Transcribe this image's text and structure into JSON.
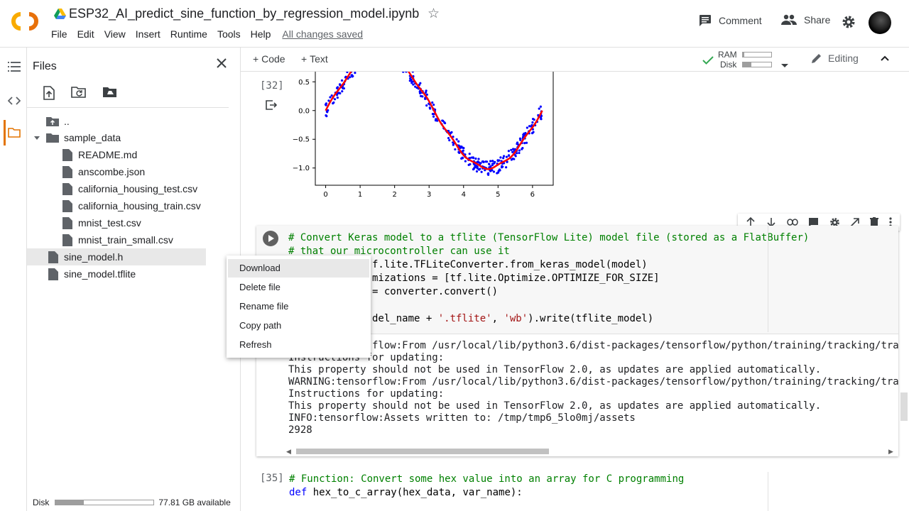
{
  "header": {
    "title": "ESP32_AI_predict_sine_function_by_regression_model.ipynb",
    "menu": [
      "File",
      "Edit",
      "View",
      "Insert",
      "Runtime",
      "Tools",
      "Help"
    ],
    "save_status": "All changes saved",
    "comment_label": "Comment",
    "share_label": "Share"
  },
  "files": {
    "title": "Files",
    "tree": [
      {
        "name": "..",
        "kind": "parent"
      },
      {
        "name": "sample_data",
        "kind": "folder"
      },
      {
        "name": "README.md",
        "kind": "file"
      },
      {
        "name": "anscombe.json",
        "kind": "file"
      },
      {
        "name": "california_housing_test.csv",
        "kind": "file"
      },
      {
        "name": "california_housing_train.csv",
        "kind": "file"
      },
      {
        "name": "mnist_test.csv",
        "kind": "file"
      },
      {
        "name": "mnist_train_small.csv",
        "kind": "file"
      },
      {
        "name": "sine_model.h",
        "kind": "file"
      },
      {
        "name": "sine_model.tflite",
        "kind": "file"
      }
    ],
    "disk_label": "Disk",
    "disk_available": "77.81 GB available",
    "disk_usage_fraction": 0.29
  },
  "toolbar": {
    "add_code": "Code",
    "add_text": "Text",
    "ram_label": "RAM",
    "disk_label": "Disk",
    "ram_fraction": 0.04,
    "disk_fraction": 0.3,
    "editing_label": "Editing"
  },
  "context_menu": [
    "Download",
    "Delete file",
    "Rename file",
    "Copy path",
    "Refresh"
  ],
  "cells": {
    "prev_output_count": "[32]",
    "next_count": "[35]"
  },
  "chart_data": {
    "type": "scatter",
    "x_ticks": [
      "0",
      "1",
      "2",
      "3",
      "4",
      "5",
      "6"
    ],
    "y_ticks": [
      "0.5",
      "0.0",
      "−0.5",
      "−1.0"
    ],
    "xlim": [
      -0.3,
      6.6
    ],
    "ylim": [
      -1.3,
      0.8
    ],
    "series": [
      {
        "kind": "scatter-noisy-sine",
        "color": "#0000ff"
      },
      {
        "kind": "line-sine-prediction",
        "color": "#ff0000"
      }
    ]
  },
  "colors": {
    "accent": "#e37400",
    "scatter": "#0000ff",
    "prediction": "#ff0000"
  }
}
